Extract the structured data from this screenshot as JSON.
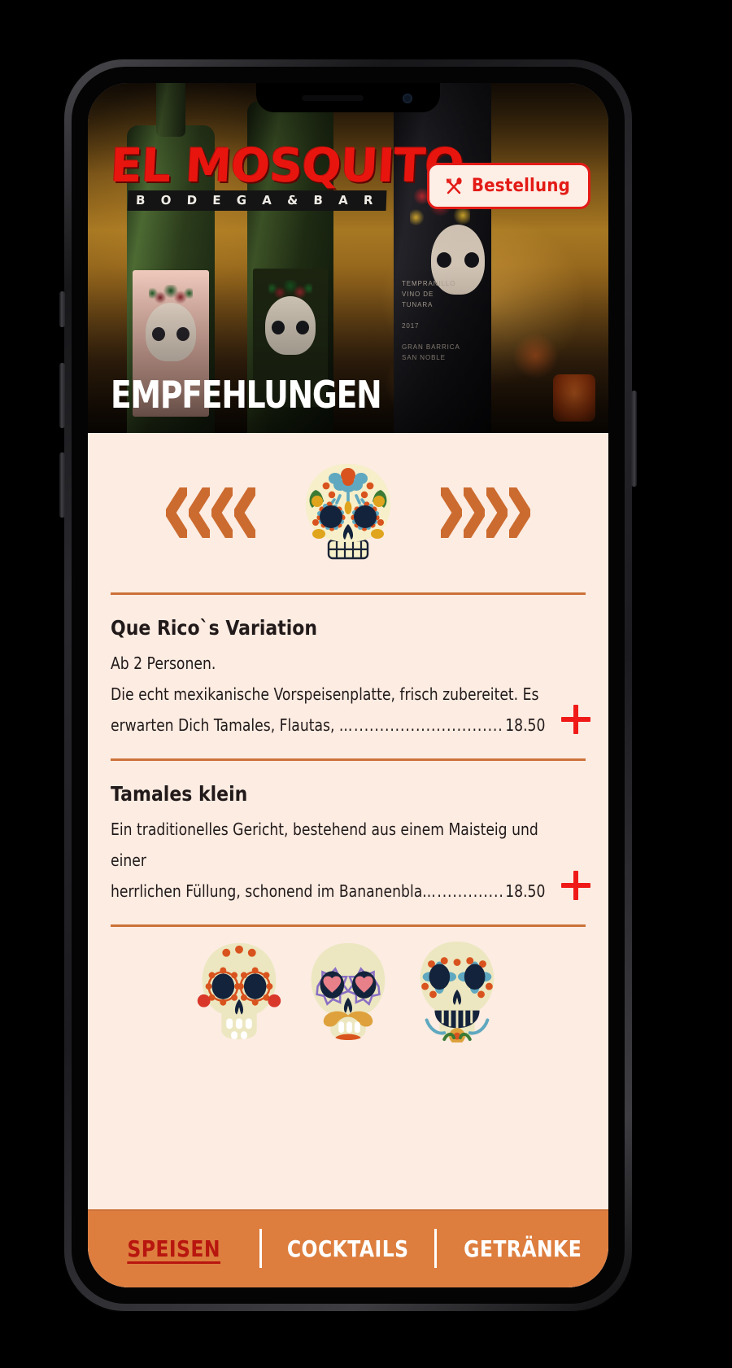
{
  "app": {
    "brand_line1": "EL MOSQUITO",
    "brand_line2": "B O D E G A  &  B A R",
    "hero_title": "EMPFEHLUNGEN"
  },
  "header": {
    "order_button_label": "Bestellung",
    "order_button_icon": "crossed-cutlery-icon",
    "order_button_text_color": "#e31b16",
    "order_button_bg": "#fdeee6"
  },
  "carousel": {
    "prev_icon": "chevron-left-group-icon",
    "next_icon": "chevron-right-group-icon",
    "center_icon": "sugar-skull-icon",
    "chevron_color": "#cc6b2f"
  },
  "menu": {
    "items": [
      {
        "title": "Que Rico`s Variation",
        "desc_line1": "Ab 2 Personen.",
        "desc_line2": "Die echt mexikanische Vorspeisenplatte, frisch zubereitet. Es",
        "desc_line3": "erwarten Dich Tamales, Flautas, ...",
        "dots": "...........................................",
        "price": "18.50",
        "add_label": "+"
      },
      {
        "title": "Tamales klein",
        "desc_line1": "Ein traditionelles Gericht, bestehend aus einem Maisteig und einer",
        "desc_line2": "",
        "desc_line3": "herrlichen Füllung, schonend im Bananenbla...",
        "dots": "...................",
        "price": "18.50",
        "add_label": "+"
      }
    ]
  },
  "bottom_nav": {
    "tabs": [
      {
        "label": "SPEISEN",
        "active": true
      },
      {
        "label": "COCKTAILS",
        "active": false
      },
      {
        "label": "GETRÄNKE",
        "active": false
      }
    ],
    "bg_color": "#dd7e3f",
    "active_color": "#b8160f"
  },
  "theme": {
    "page_bg": "#fcece2",
    "divider": "#cc7238",
    "accent_red": "#ef1a17",
    "text": "#221a1a"
  }
}
